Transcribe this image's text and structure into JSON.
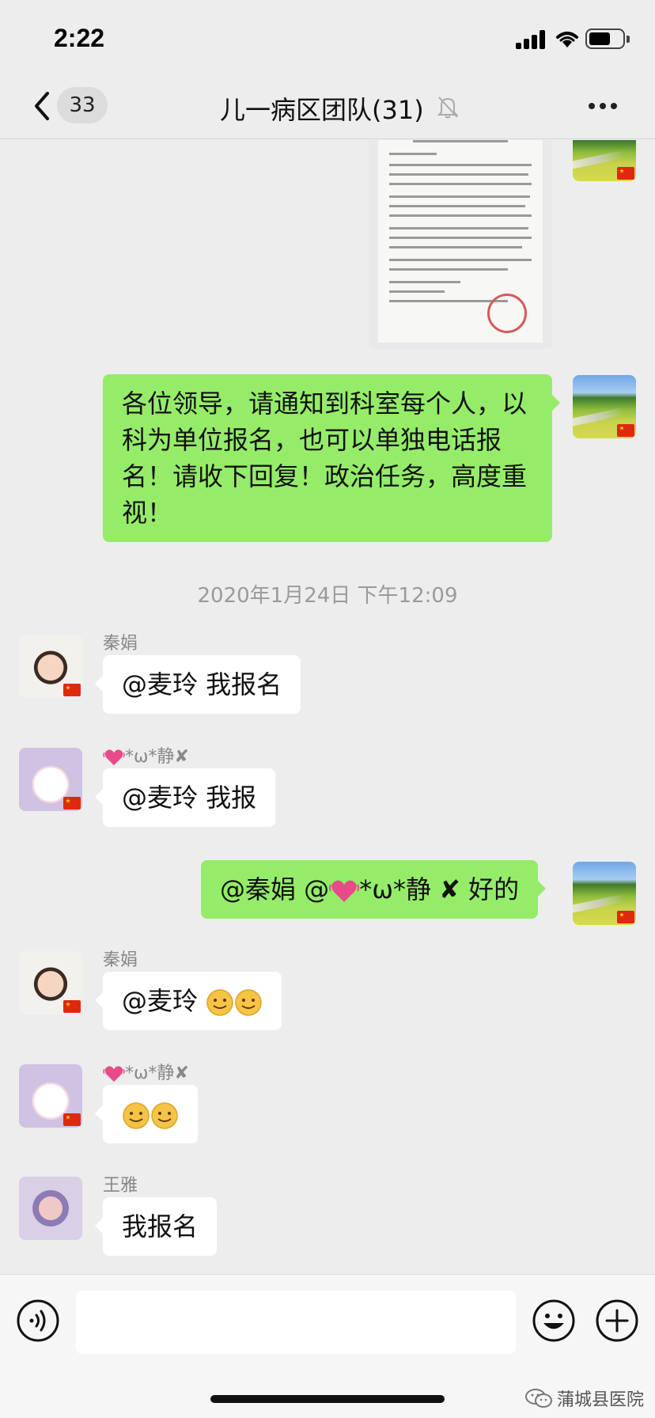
{
  "status_bar": {
    "time": "2:22"
  },
  "nav": {
    "unread_count": "33",
    "title": "儿一病区团队(31)"
  },
  "messages": {
    "m1": {
      "text": "各位领导，请通知到科室每个人，以科为单位报名，也可以单独电话报名！请收下回复！政治任务，高度重视！"
    },
    "timestamp": "2020年1月24日 下午12:09",
    "m2": {
      "sender": "秦娟",
      "text": "@麦玲 我报名"
    },
    "m3": {
      "sender": "*ω*静",
      "text": "@麦玲   我报"
    },
    "m4": {
      "text_1": "@秦娟 @",
      "text_2": "*ω*静",
      "text_3": "好的"
    },
    "m5": {
      "sender": "秦娟",
      "text": "@麦玲"
    },
    "m6": {
      "sender": "*ω*静"
    },
    "m7": {
      "sender": "王雅",
      "text": "我报名"
    }
  },
  "input": {
    "value": ""
  },
  "watermark": "蒲城县医院",
  "icons": {
    "back": "chevron-left-icon",
    "mute": "bell-off-icon",
    "more": "more-icon",
    "voice": "voice-icon",
    "emoji": "emoji-icon",
    "plus": "plus-icon"
  },
  "colors": {
    "background": "#ededed",
    "bubble_self": "#95ec69",
    "bubble_other": "#ffffff"
  }
}
